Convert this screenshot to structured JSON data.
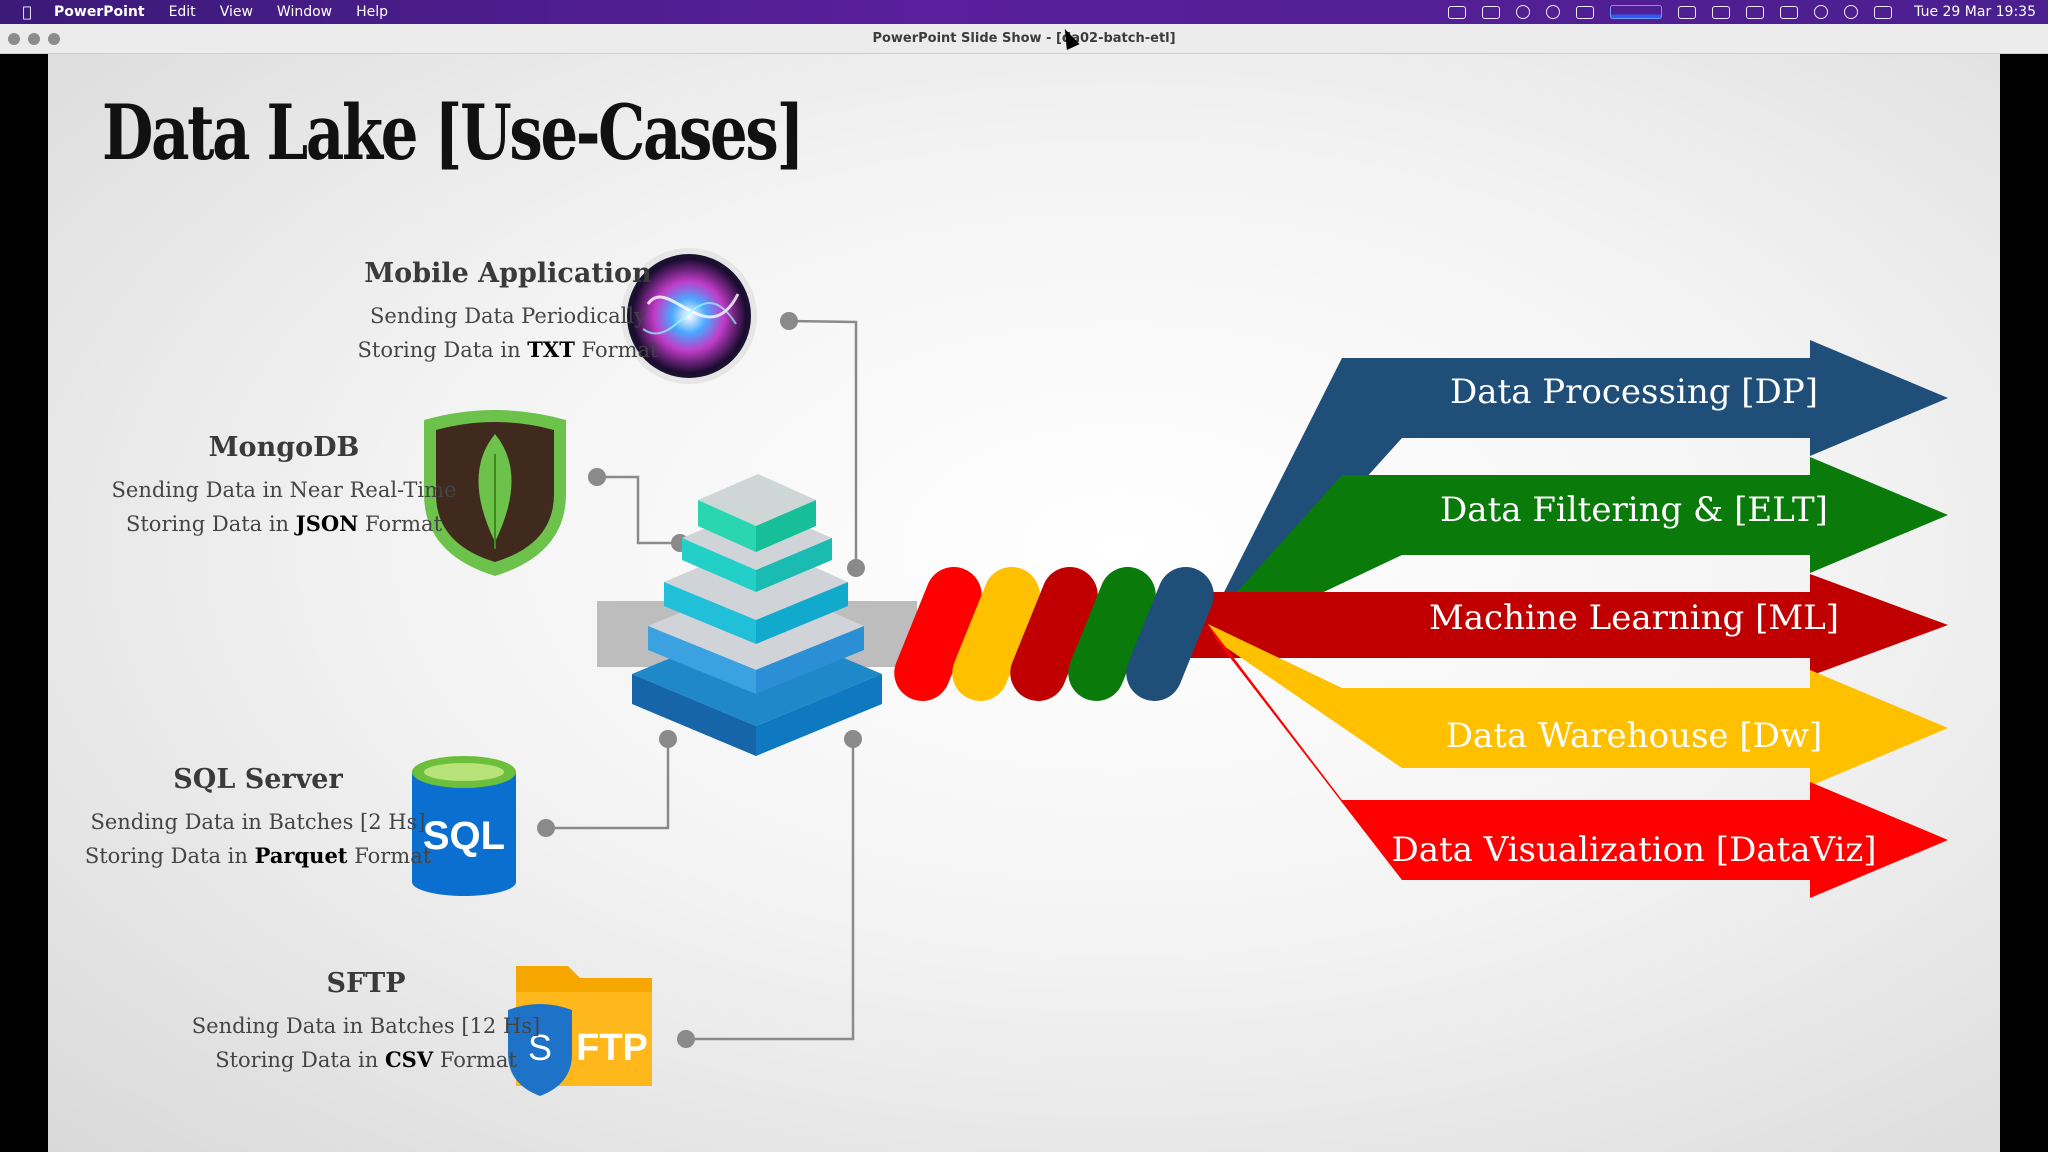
{
  "menubar": {
    "app": "PowerPoint",
    "items": [
      "Edit",
      "View",
      "Window",
      "Help"
    ],
    "clock": "Tue 29 Mar  19:35"
  },
  "window": {
    "title": "PowerPoint Slide Show - [da02-batch-etl]"
  },
  "slide": {
    "title": "Data Lake [Use-Cases]",
    "sources": [
      {
        "name": "Mobile Application",
        "line1": "Sending Data Periodically",
        "line2_prefix": "Storing Data in ",
        "line2_format": "TXT",
        "line2_suffix": " Format",
        "icon": "siri-icon"
      },
      {
        "name": "MongoDB",
        "line1": "Sending Data in Near Real-Time",
        "line2_prefix": "Storing Data in ",
        "line2_format": "JSON",
        "line2_suffix": " Format",
        "icon": "mongodb-leaf-icon"
      },
      {
        "name": "SQL Server",
        "line1": "Sending Data in Batches [2 Hs]",
        "line2_prefix": "Storing Data in ",
        "line2_format": "Parquet",
        "line2_suffix": " Format",
        "icon": "sql-database-icon"
      },
      {
        "name": "SFTP",
        "line1": "Sending Data in Batches [12 Hs]",
        "line2_prefix": "Storing Data in ",
        "line2_format": "CSV",
        "line2_suffix": " Format",
        "icon": "sftp-folder-icon"
      }
    ],
    "sftp_icon_text": "FTP",
    "sftp_shield_letter": "S",
    "sql_icon_text": "SQL",
    "use_cases": [
      {
        "label": "Data Processing [DP]",
        "color": "#1f4e79"
      },
      {
        "label": "Data Filtering & [ELT]",
        "color": "#0a7a0a"
      },
      {
        "label": "Machine Learning [ML]",
        "color": "#c00000"
      },
      {
        "label": "Data Warehouse [Dw]",
        "color": "#ffc000"
      },
      {
        "label": "Data Visualization [DataViz]",
        "color": "#ff0000"
      }
    ],
    "pill_colors": [
      "#ff0000",
      "#ffc000",
      "#c00000",
      "#0a7a0a",
      "#1f4e79"
    ]
  }
}
